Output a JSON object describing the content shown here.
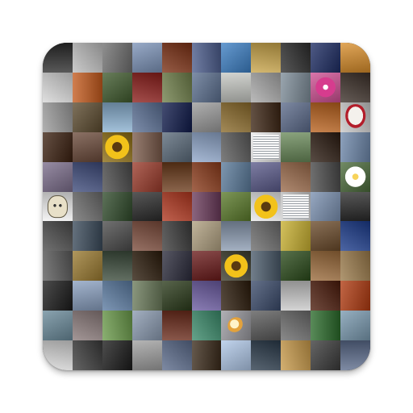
{
  "app_icon": {
    "name": "photo-mosaic-app-icon",
    "grid": {
      "columns": 11,
      "rows": 11
    },
    "tiles": [
      [
        "#2a2a2a",
        "#bdbdbd",
        "#6f6f6f",
        "#7c93b8",
        "#7a2f13",
        "#4b5c8c",
        "#3c7fc4",
        "#c9a54a",
        "#2b2b2b",
        "#1d2c63",
        "#d98e2b"
      ],
      [
        "#d7d7d7",
        "#c45a1d",
        "#3f5a2d",
        "#8b1d1a",
        "#6f7f4a",
        "#5b6f8f",
        "#c7c9c4",
        "#a8a8a8",
        "#7d8c98",
        "#cf4f93",
        "#3b2f28"
      ],
      [
        "#9b9b9b",
        "#5b4a2e",
        "#8ab0d0",
        "#5a6f94",
        "#0f1a4a",
        "#9a9a9a",
        "#8a6a2a",
        "#3b2413",
        "#5b6a8a",
        "#b8611d",
        "#c8c8c8"
      ],
      [
        "#3b2010",
        "#6b4a3a",
        "#8a6a10",
        "#7a5a4a",
        "#5a6a7a",
        "#8fa6c9",
        "#5a5a5a",
        "#eaeaea",
        "#6a8a5a",
        "#2a1a10",
        "#6d87aa"
      ],
      [
        "#7b6d8b",
        "#3d4a7a",
        "#4a4a4a",
        "#9a3a2a",
        "#6a3a1a",
        "#8a3a1a",
        "#5a7a9a",
        "#5a5a8a",
        "#9a6a4a",
        "#4a4a4a",
        "#4a6a3a"
      ],
      [
        "#f2f2f2",
        "#6b6b6b",
        "#2f4a2a",
        "#2a2a2a",
        "#b0361e",
        "#6a3a5a",
        "#5a7a2a",
        "#e8e8e8",
        "#d0d0d0",
        "#7a90b0",
        "#2a2a2a"
      ],
      [
        "#4a4a4a",
        "#3a4a5a",
        "#4a4a4a",
        "#7a4a3a",
        "#3a3a3a",
        "#b0a080",
        "#8a9ab0",
        "#6a6a6a",
        "#c8b030",
        "#6a4a2a",
        "#1a3a8a"
      ],
      [
        "#5a5a5a",
        "#9a7a30",
        "#3a4a3a",
        "#2a1a0a",
        "#2a2a3a",
        "#6a1a1a",
        "#3a3a2a",
        "#4a5a6a",
        "#2a4a1a",
        "#9a6a3a",
        "#9a7a4a"
      ],
      [
        "#1a1a1a",
        "#8aa0c0",
        "#5a7aa0",
        "#6a7a5a",
        "#2a3a1a",
        "#6a5aa0",
        "#2a1a0a",
        "#3a4a6a",
        "#c8c8c8",
        "#4a1a0a",
        "#b03a10"
      ],
      [
        "#6a8a9a",
        "#8a7a7a",
        "#6a9a4a",
        "#8a9ab0",
        "#6a2a1a",
        "#3a8a6a",
        "#9a9aa0",
        "#5a5a5a",
        "#6a6a6a",
        "#2a6a2a",
        "#7a9ab0"
      ],
      [
        "#d8d8d8",
        "#3a3a3a",
        "#1a1a1a",
        "#a0a0a0",
        "#5a6a8a",
        "#3a2a1a",
        "#b0c8e8",
        "#2a3a4a",
        "#c89a4a",
        "#3a3a3a",
        "#5a6a8a"
      ]
    ],
    "motifs": [
      {
        "row": 3,
        "col": 2,
        "kind": "sunflower"
      },
      {
        "row": 5,
        "col": 7,
        "kind": "sunflower"
      },
      {
        "row": 7,
        "col": 6,
        "kind": "sunflower"
      },
      {
        "row": 4,
        "col": 10,
        "kind": "flower"
      },
      {
        "row": 1,
        "col": 9,
        "kind": "orchid"
      },
      {
        "row": 2,
        "col": 10,
        "kind": "mask"
      },
      {
        "row": 9,
        "col": 6,
        "kind": "moon"
      },
      {
        "row": 5,
        "col": 8,
        "kind": "doc"
      },
      {
        "row": 3,
        "col": 7,
        "kind": "doc"
      },
      {
        "row": 5,
        "col": 0,
        "kind": "robot"
      }
    ]
  }
}
